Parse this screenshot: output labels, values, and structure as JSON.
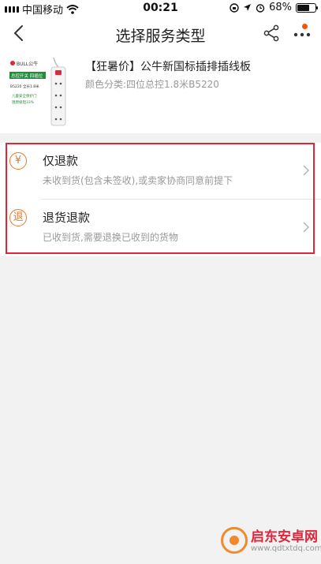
{
  "status": {
    "carrier": "中国移动",
    "time": "00:21",
    "battery_text": "68%",
    "battery_level": 0.68
  },
  "nav": {
    "title": "选择服务类型"
  },
  "product": {
    "title": "【狂暑价】公牛新国标插排插线板",
    "sku": "颜色分类:四位总控1.8米B5220",
    "thumb": {
      "brand": "BULL公牛",
      "badge": "总控开关 四插位",
      "model": "B5220 全长1.8米",
      "feature1": "儿童安全保护门",
      "feature2": "阻燃极阻33%"
    }
  },
  "options": [
    {
      "icon_char": "¥",
      "title": "仅退款",
      "desc": "未收到货(包含未签收),或卖家协商同意前提下"
    },
    {
      "icon_char": "退",
      "title": "退货退款",
      "desc": "已收到货,需要退换已收到的货物"
    }
  ],
  "watermark": {
    "line1": "启东安卓网",
    "line2": "www.qdtxtdq.com"
  },
  "colors": {
    "accent": "#e4782a",
    "highlight": "#e0263a",
    "notify": "#ff5000"
  }
}
